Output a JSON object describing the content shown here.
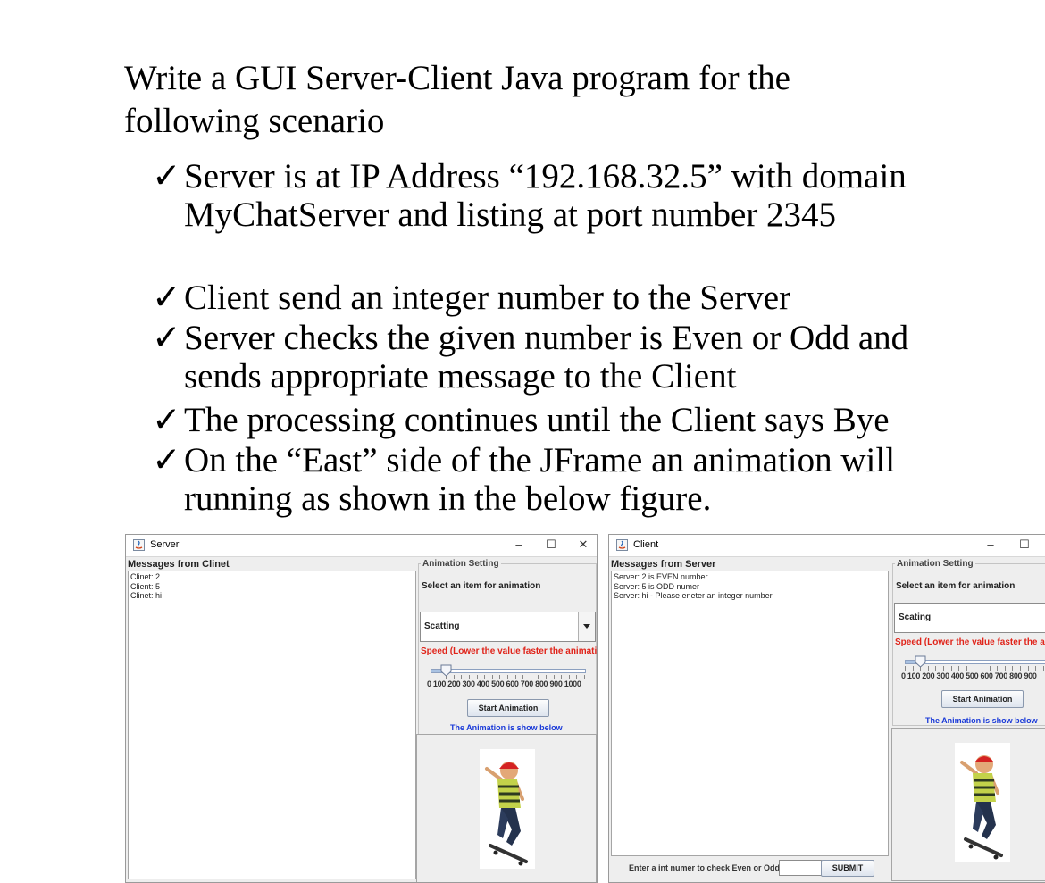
{
  "document": {
    "title": "Write a GUI Server-Client Java program for the following scenario",
    "check_glyph": "✓",
    "bullets": [
      "Server is at IP Address “192.168.32.5” with domain MyChatServer and listing at port number 2345",
      "Client send an integer number to the Server",
      "Server checks the given number is Even or Odd and sends appropriate message to the Client",
      "The processing continues until the Client says Bye",
      "On the “East” side of the JFrame an animation will running as shown in the below figure."
    ]
  },
  "server_window": {
    "title": "Server",
    "buttons": {
      "minimize": "–",
      "maximize": "☐",
      "close": "✕"
    },
    "messages_label": "Messages from Clinet",
    "messages": [
      "Clinet: 2",
      "Client: 5",
      "Clinet: hi"
    ],
    "animation_setting_label": "Animation Setting",
    "select_label": "Select an item for animation",
    "combo_value": "Scatting",
    "speed_label": "Speed (Lower the value faster the animation)",
    "slider_value": 100,
    "slider_max": 1000,
    "tick_labels": "0  100 200 300 400 500 600 700 800 900 1000",
    "start_button": "Start Animation",
    "animation_caption": "The Animation is show below"
  },
  "client_window": {
    "title": "Client",
    "buttons": {
      "minimize": "–",
      "maximize": "☐"
    },
    "messages_label": "Messages from Server",
    "messages": [
      "Server: 2 is EVEN number",
      "Server: 5 is ODD numer",
      "Server: hi - Please eneter an integer number"
    ],
    "animation_setting_label": "Animation Setting",
    "select_label": "Select an item for animation",
    "combo_value": "Scating",
    "speed_label": "Speed (Lower the value faster the anima",
    "slider_value": 100,
    "slider_max": 1000,
    "tick_labels": "0  100 200 300 400 500 600 700 800 900",
    "start_button": "Start Animation",
    "animation_caption": "The Animation is show below",
    "input_label": "Enter a int numer to check Even or Odd",
    "input_value": "",
    "submit_button": "SUBMIT"
  },
  "colors": {
    "speed_label": "#e0241a",
    "animation_caption": "#1a3ad8",
    "window_bg": "#eeeeee"
  }
}
